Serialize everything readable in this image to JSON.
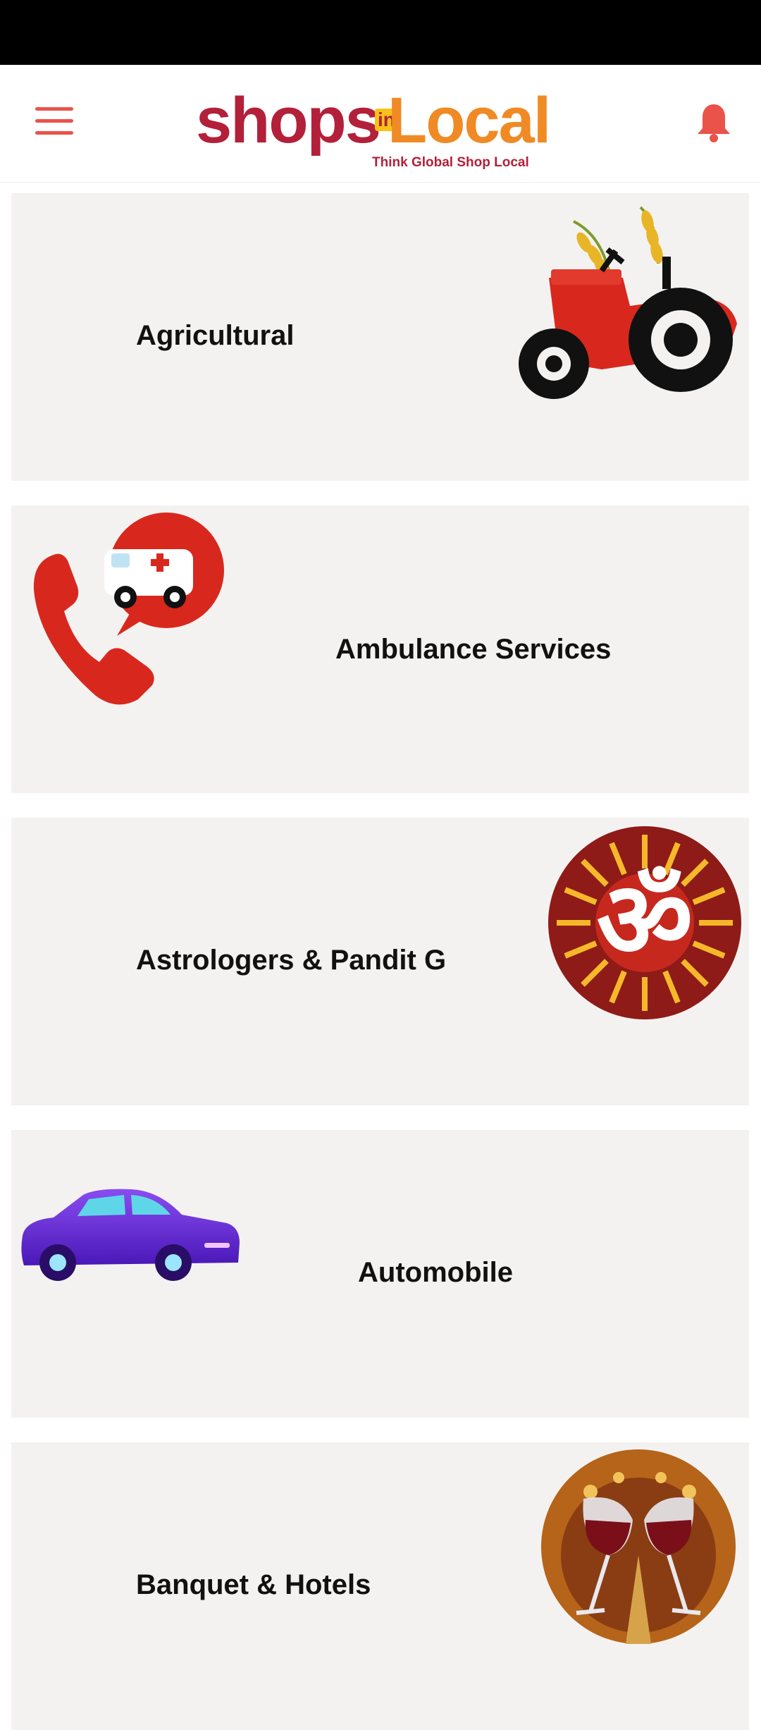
{
  "header": {
    "logo": {
      "shops": "shops",
      "in": "in",
      "local": "Local",
      "tagline": "Think Global Shop Local"
    },
    "menu_icon": "hamburger-menu-icon",
    "bell_icon": "bell-icon",
    "accent_color": "#e9534a"
  },
  "categories": [
    {
      "label": "Agricultural",
      "image": "tractor-illustration"
    },
    {
      "label": "Ambulance Services",
      "image": "phone-ambulance-illustration"
    },
    {
      "label": "Astrologers & Pandit G",
      "image": "om-symbol-illustration"
    },
    {
      "label": "Automobile",
      "image": "car-illustration"
    },
    {
      "label": "Banquet & Hotels",
      "image": "wine-glasses-banquet-illustration"
    }
  ]
}
